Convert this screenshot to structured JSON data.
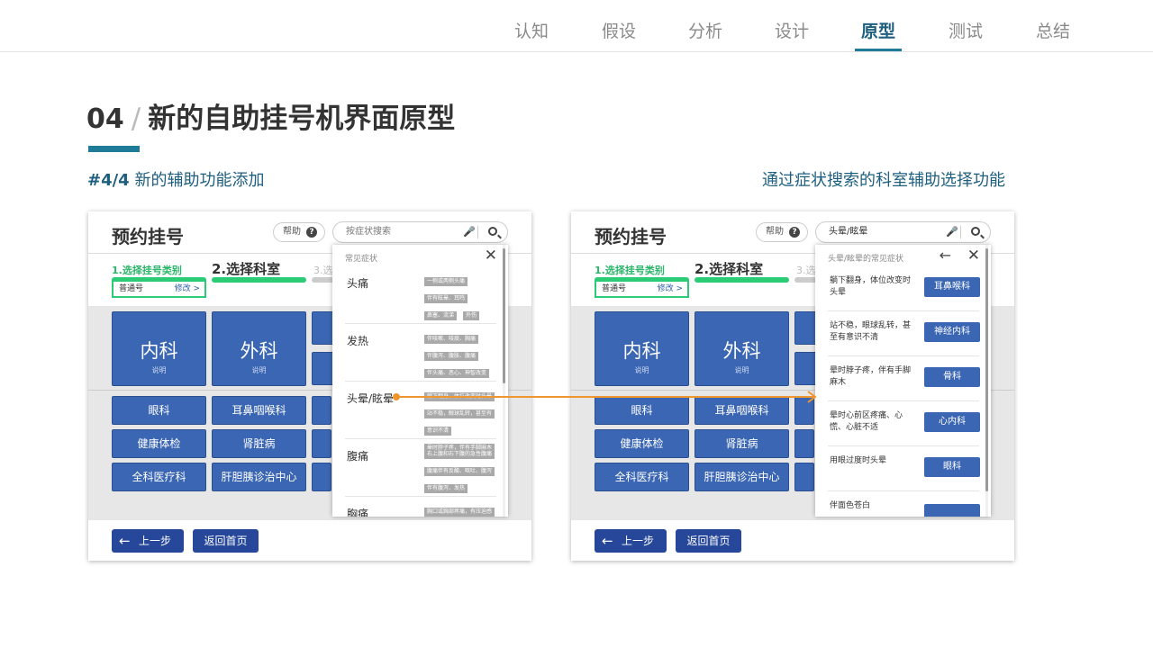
{
  "nav": {
    "items": [
      "认知",
      "假设",
      "分析",
      "设计",
      "原型",
      "测试",
      "总结"
    ],
    "active": "原型"
  },
  "header": {
    "number": "04",
    "slash": "/",
    "title": "新的自助挂号机界面原型",
    "subtitle_tag": "#4/4",
    "subtitle_left": "新的辅助功能添加",
    "subtitle_right": "通过症状搜索的科室辅助选择功能"
  },
  "colors": {
    "accent": "#1f7c98",
    "primary_button": "#3a66b3",
    "nav_button": "#26479a",
    "progress": "#2bcc75",
    "arrow": "#f0962e"
  },
  "kiosk_left": {
    "title": "预约挂号",
    "help": "帮助",
    "help_icon": "?",
    "search_placeholder": "按症状搜索",
    "step1": "1.选择挂号类别",
    "step2": "2.选择科室",
    "step3": "3.选",
    "selection": "普通号",
    "modify": "修改 >",
    "big_buttons": [
      {
        "label": "内科",
        "sub": "说明"
      },
      {
        "label": "外科",
        "sub": "说明"
      }
    ],
    "small_buttons": [
      [
        "眼科",
        "耳鼻咽喉科"
      ],
      [
        "健康体检",
        "肾脏病"
      ],
      [
        "全科医疗科",
        "肝胆胰诊治中心"
      ]
    ],
    "back": "上一步",
    "home": "返回首页",
    "popup": {
      "header": "常见症状",
      "close_icon": "✕",
      "symptoms": [
        {
          "name": "头痛",
          "tags": [
            "一侧或两侧头痛",
            "伴有眩晕、耳鸣",
            "鼻塞、流涕",
            "外伤"
          ]
        },
        {
          "name": "发热",
          "tags": [
            "伴咳嗽、咳痰、胸痛",
            "伴腹泻、腹胀、腹痛",
            "伴头痛、恶心、神智改变",
            ""
          ]
        },
        {
          "name": "头晕/眩晕",
          "tags": [
            "躺下翻身，体位改变时头晕",
            "站不稳，眼球乱转，甚至有",
            "意识不清",
            "晕时脖子疼，伴有手脚麻木"
          ]
        },
        {
          "name": "腹痛",
          "tags": [
            "右上腹和右下腹的急性腹痛",
            "腹痛伴有反酸、呕吐、腹泻",
            "伴有腹泻、发热"
          ]
        },
        {
          "name": "胸痛",
          "tags": [
            "胸口或胸部疼痛，有压迫感"
          ]
        }
      ]
    }
  },
  "kiosk_right": {
    "title": "预约挂号",
    "help": "帮助",
    "help_icon": "?",
    "search_value": "头晕/眩晕",
    "step1": "1.选择挂号类别",
    "step2": "2.选择科室",
    "step3": "3.选",
    "selection": "普通号",
    "modify": "修改 >",
    "big_buttons": [
      {
        "label": "内科",
        "sub": "说明"
      },
      {
        "label": "外科",
        "sub": "说明"
      }
    ],
    "small_buttons": [
      [
        "眼科",
        "耳鼻咽喉科"
      ],
      [
        "健康体检",
        "肾脏病"
      ],
      [
        "全科医疗科",
        "肝胆胰诊治中心"
      ]
    ],
    "back": "上一步",
    "home": "返回首页",
    "popup": {
      "header": "头晕/眩晕的常见症状",
      "back_icon": "←",
      "close_icon": "✕",
      "rows": [
        {
          "symptom": "躺下翻身，体位改变时头晕",
          "dept": "耳鼻喉科"
        },
        {
          "symptom": "站不稳，眼球乱转，甚至有意识不清",
          "dept": "神经内科"
        },
        {
          "symptom": "晕时脖子疼，伴有手脚麻木",
          "dept": "骨科"
        },
        {
          "symptom": "晕时心前区疼痛、心慌、心脏不适",
          "dept": "心内科"
        },
        {
          "symptom": "用眼过度时头晕",
          "dept": "眼科"
        },
        {
          "symptom": "伴面色苍白",
          "dept": ""
        }
      ]
    }
  }
}
